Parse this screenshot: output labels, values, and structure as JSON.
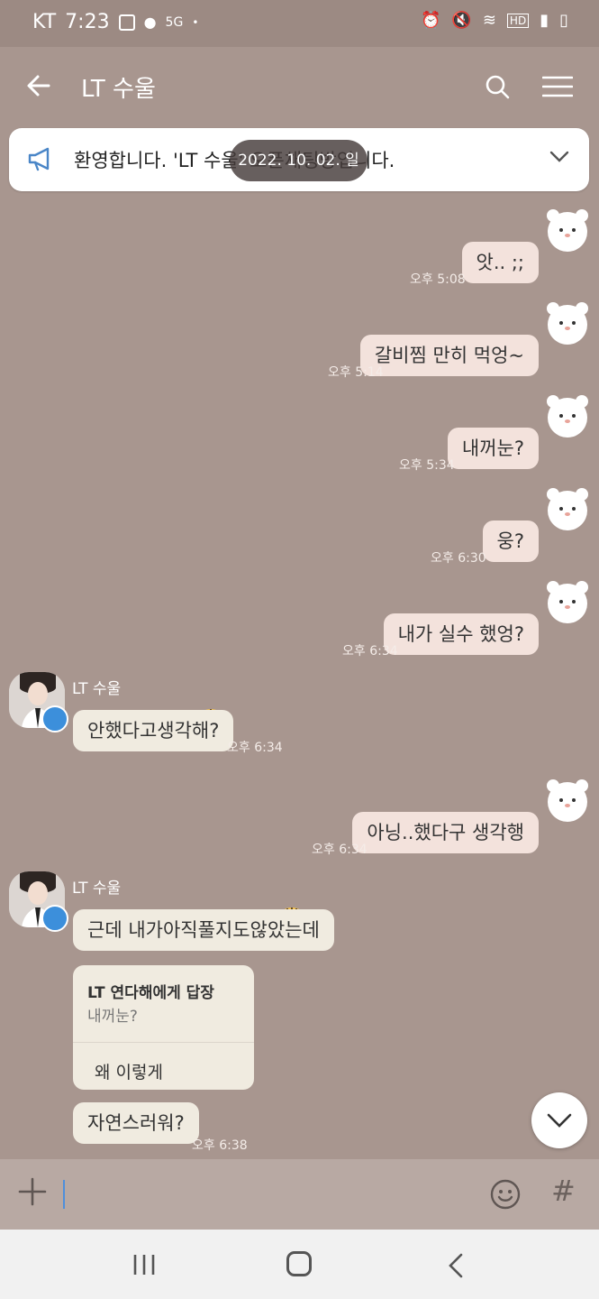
{
  "status_bar": {
    "carrier": "KT",
    "time": "7:23",
    "signal_label": "5G"
  },
  "header": {
    "title": "LT 수울"
  },
  "notice": {
    "text": "환영합니다. 'LT 수울' 오픈채팅방입니다."
  },
  "date_pill": "2022. 10. 02. 일",
  "messages": {
    "m1": {
      "text": "앗.. ;;",
      "time": "오후 5:08"
    },
    "m2": {
      "text": "갈비찜 만히 먹엉~",
      "time": "오후 5:14"
    },
    "m3": {
      "text": "내꺼눈?",
      "time": "오후 5:34"
    },
    "m4": {
      "text": "웅?",
      "time": "오후 6:30"
    },
    "m5": {
      "text": "내가 실수 했엉?",
      "time": "오후 6:34"
    },
    "m6": {
      "sender": "LT 수울",
      "text": "안했다고생각해?",
      "time": "오후 6:34"
    },
    "m7": {
      "text": "아닝..했다구 생각행",
      "time": "오후 6:34"
    },
    "m8": {
      "sender": "LT 수울",
      "text": "근데 내가아직풀지도않았는데"
    },
    "m9": {
      "reply_to": "LT 연다해에게 답장",
      "quoted": "내꺼눈?",
      "text": "왜 이렇게"
    },
    "m10": {
      "text": "자연스러워?",
      "time": "오후 6:38"
    }
  },
  "colors": {
    "background": "#a8968f",
    "bubble_out": "#f3e2dc",
    "bubble_in": "#f0ebe0",
    "accent": "#3c8fdb"
  },
  "icons": [
    "back-arrow-icon",
    "search-icon",
    "hamburger-menu-icon",
    "megaphone-icon",
    "chevron-down-icon",
    "plus-icon",
    "emoji-icon",
    "hashtag-icon",
    "recents-icon",
    "home-icon",
    "nav-back-icon"
  ]
}
